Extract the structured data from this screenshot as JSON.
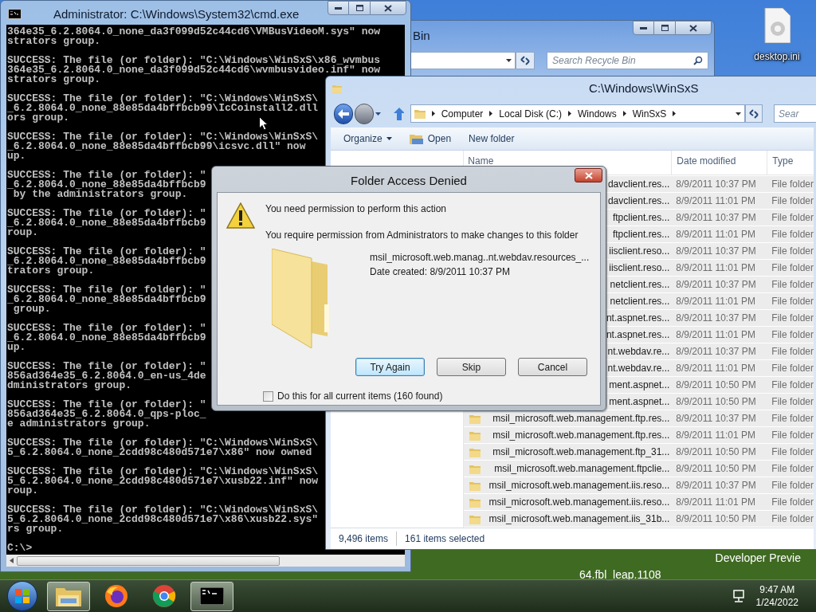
{
  "desktop": {
    "icons": [
      {
        "label": "desktop.ini"
      }
    ],
    "build_text": [
      "Developer Previe",
      "64.fbl_leap.1108"
    ]
  },
  "cmd_window": {
    "title": "Administrator: C:\\Windows\\System32\\cmd.exe",
    "blocks": [
      [
        "364e35_6.2.8064.0_none_da3f099d52c44cd6\\VMBusVideoM.sys\" now",
        "strators group."
      ],
      [
        "SUCCESS: The file (or folder): \"C:\\Windows\\WinSxS\\x86_wvmbus",
        "364e35_6.2.8064.0_none_da3f099d52c44cd6\\wvmbusvideo.inf\" now",
        "strators group."
      ],
      [
        "SUCCESS: The file (or folder): \"C:\\Windows\\WinSxS\\",
        "_6.2.8064.0_none_88e85da4bffbcb99\\IcCoinstall2.dll",
        "ors group."
      ],
      [
        "SUCCESS: The file (or folder): \"C:\\Windows\\WinSxS\\",
        "_6.2.8064.0_none_88e85da4bffbcb99\\icsvc.dll\" now",
        "up."
      ],
      [
        "SUCCESS: The file (or folder): \"",
        "_6.2.8064.0_none_88e85da4bffbcb9",
        " by the administrators group."
      ],
      [
        "SUCCESS: The file (or folder): \"",
        "_6.2.8064.0_none_88e85da4bffbcb9",
        "roup."
      ],
      [
        "SUCCESS: The file (or folder): \"",
        "_6.2.8064.0_none_88e85da4bffbcb9",
        "trators group."
      ],
      [
        "SUCCESS: The file (or folder): \"",
        "_6.2.8064.0_none_88e85da4bffbcb9",
        " group."
      ],
      [
        "SUCCESS: The file (or folder): \"",
        "_6.2.8064.0_none_88e85da4bffbcb9",
        "up."
      ],
      [
        "SUCCESS: The file (or folder): \"",
        "856ad364e35_6.2.8064.0_en-us_4de",
        "dministrators group."
      ],
      [
        "SUCCESS: The file (or folder): \"",
        "856ad364e35_6.2.8064.0_qps-ploc_",
        "e administrators group."
      ],
      [
        "SUCCESS: The file (or folder): \"C:\\Windows\\WinSxS\\",
        "5_6.2.8064.0_none_2cdd98c480d571e7\\x86\" now owned"
      ],
      [
        "SUCCESS: The file (or folder): \"C:\\Windows\\WinSxS\\",
        "5_6.2.8064.0_none_2cdd98c480d571e7\\xusb22.inf\" now",
        "roup."
      ],
      [
        "SUCCESS: The file (or folder): \"C:\\Windows\\WinSxS\\",
        "5_6.2.8064.0_none_2cdd98c480d571e7\\x86\\xusb22.sys\"",
        "rs group."
      ]
    ],
    "prompt": "C:\\>"
  },
  "recycle_window": {
    "title": "Bin",
    "search": {
      "placeholder": "Search Recycle Bin"
    }
  },
  "explorer": {
    "title": "C:\\Windows\\WinSxS",
    "breadcrumb": [
      "Computer",
      "Local Disk (C:)",
      "Windows",
      "WinSxS"
    ],
    "search": {
      "placeholder": "Sear"
    },
    "toolbar": [
      {
        "label": "Organize",
        "kind": "menu"
      },
      {
        "label": "Open",
        "kind": "open"
      },
      {
        "label": "New folder",
        "kind": "plain"
      }
    ],
    "columns": [
      "Name",
      "Date modified",
      "Type"
    ],
    "rows": [
      {
        "name": "davclient.res...",
        "date": "8/9/2011 10:37 PM",
        "type": "File folder",
        "covered": true,
        "selected": true
      },
      {
        "name": "davclient.res...",
        "date": "8/9/2011 11:01 PM",
        "type": "File folder",
        "covered": true,
        "selected": true
      },
      {
        "name": "ftpclient.res...",
        "date": "8/9/2011 10:37 PM",
        "type": "File folder",
        "covered": true,
        "selected": true
      },
      {
        "name": "ftpclient.res...",
        "date": "8/9/2011 11:01 PM",
        "type": "File folder",
        "covered": true,
        "selected": true
      },
      {
        "name": "iisclient.reso...",
        "date": "8/9/2011 10:37 PM",
        "type": "File folder",
        "covered": true,
        "selected": true
      },
      {
        "name": "iisclient.reso...",
        "date": "8/9/2011 11:01 PM",
        "type": "File folder",
        "covered": true,
        "selected": true
      },
      {
        "name": "netclient.res...",
        "date": "8/9/2011 10:37 PM",
        "type": "File folder",
        "covered": true,
        "selected": true
      },
      {
        "name": "netclient.res...",
        "date": "8/9/2011 11:01 PM",
        "type": "File folder",
        "covered": true,
        "selected": true
      },
      {
        "name": "nt.aspnet.res...",
        "date": "8/9/2011 10:37 PM",
        "type": "File folder",
        "covered": true,
        "selected": true
      },
      {
        "name": "nt.aspnet.res...",
        "date": "8/9/2011 11:01 PM",
        "type": "File folder",
        "covered": true,
        "selected": true
      },
      {
        "name": "nt.webdav.re...",
        "date": "8/9/2011 10:37 PM",
        "type": "File folder",
        "covered": true,
        "selected": true
      },
      {
        "name": "nt.webdav.re...",
        "date": "8/9/2011 11:01 PM",
        "type": "File folder",
        "covered": true,
        "selected": true
      },
      {
        "name": "ment.aspnet...",
        "date": "8/9/2011 10:50 PM",
        "type": "File folder",
        "covered": true,
        "selected": true
      },
      {
        "name": "ment.aspnet...",
        "date": "8/9/2011 10:50 PM",
        "type": "File folder",
        "covered": true,
        "selected": true
      },
      {
        "name": "msil_microsoft.web.management.ftp.res...",
        "date": "8/9/2011 10:37 PM",
        "type": "File folder",
        "covered": false,
        "selected": true
      },
      {
        "name": "msil_microsoft.web.management.ftp.res...",
        "date": "8/9/2011 11:01 PM",
        "type": "File folder",
        "covered": false,
        "selected": true
      },
      {
        "name": "msil_microsoft.web.management.ftp_31...",
        "date": "8/9/2011 10:50 PM",
        "type": "File folder",
        "covered": false,
        "selected": true
      },
      {
        "name": "msil_microsoft.web.management.ftpclie...",
        "date": "8/9/2011 10:50 PM",
        "type": "File folder",
        "covered": false,
        "selected": true
      },
      {
        "name": "msil_microsoft.web.management.iis.reso...",
        "date": "8/9/2011 10:37 PM",
        "type": "File folder",
        "covered": false,
        "selected": true
      },
      {
        "name": "msil_microsoft.web.management.iis.reso...",
        "date": "8/9/2011 11:01 PM",
        "type": "File folder",
        "covered": false,
        "selected": true
      },
      {
        "name": "msil_microsoft.web.management.iis_31b...",
        "date": "8/9/2011 10:50 PM",
        "type": "File folder",
        "covered": false,
        "selected": true
      }
    ],
    "status": [
      "9,496 items",
      "161 items selected"
    ]
  },
  "dialog": {
    "title": "Folder Access Denied",
    "heading": "You need permission to perform this action",
    "message": "You require permission from Administrators to make changes to this folder",
    "item_name": "msil_microsoft.web.manag..nt.webdav.resources_...",
    "item_date": "Date created: 8/9/2011 10:37 PM",
    "buttons": [
      {
        "label": "Try Again",
        "selected": true
      },
      {
        "label": "Skip",
        "selected": false
      },
      {
        "label": "Cancel",
        "selected": false
      }
    ],
    "checkbox": {
      "label": "Do this for all current items (160 found)",
      "checked": false
    }
  },
  "taskbar": {
    "apps": [
      {
        "kind": "explorer",
        "selected": true
      },
      {
        "kind": "firefox",
        "selected": false
      },
      {
        "kind": "chrome",
        "selected": false
      },
      {
        "kind": "cmd",
        "selected": true
      }
    ],
    "time": "9:47 AM",
    "date": "1/24/2022"
  }
}
